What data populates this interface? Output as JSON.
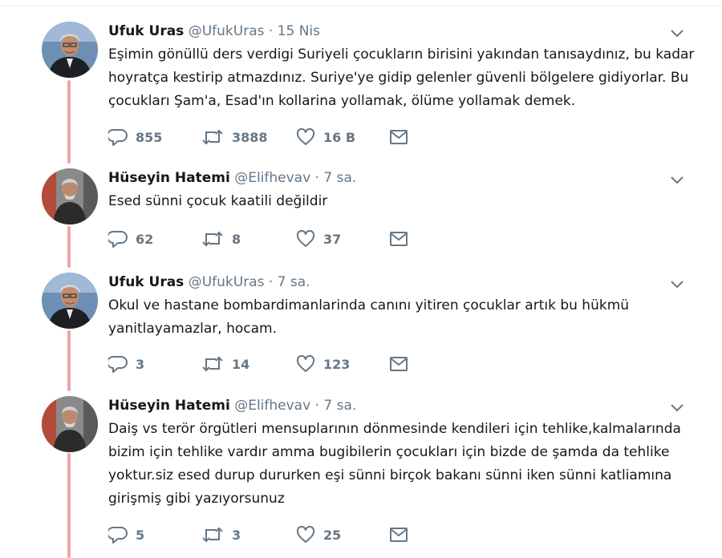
{
  "tweets": [
    {
      "name": "Ufuk Uras",
      "meta": "@UfukUras · 15 Nis",
      "text": "Eşimin gönüllü ders verdigi Suriyeli çocukların birisini yakından tanısaydınız, bu kadar hoyratça kestirip atmazdınız. Suriye'ye gidip gelenler güvenli bölgelere gidiyorlar. Bu çocukları Şam'a, Esad'ın kollarina yollamak, ölüme yollamak demek.",
      "replies": "855",
      "retweets": "3888",
      "likes": "16 B"
    },
    {
      "name": "Hüseyin Hatemi",
      "meta": "@Elifhevav · 7 sa.",
      "text": "Esed sünni çocuk kaatili değildir",
      "replies": "62",
      "retweets": "8",
      "likes": "37"
    },
    {
      "name": "Ufuk Uras",
      "meta": "@UfukUras · 7 sa.",
      "text": "Okul ve hastane bombardimanlarinda canını yitiren çocuklar artık bu hükmü yanitlayamazlar, hocam.",
      "replies": "3",
      "retweets": "14",
      "likes": "123"
    },
    {
      "name": "Hüseyin Hatemi",
      "meta": "@Elifhevav · 7 sa.",
      "text": "Daiş vs terör örgütleri mensuplarının dönmesinde kendileri için tehlike,kalmalarında bizim için tehlike vardır amma bugibilerin çocukları için bizde de şamda da tehlike yoktur.siz esed durup dururken eşi sünni birçok bakanı sünni iken sünni katliamına girişmiş gibi yazıyorsunuz",
      "replies": "5",
      "retweets": "3",
      "likes": "25"
    }
  ],
  "icons": {
    "reply": "reply-icon",
    "retweet": "retweet-icon",
    "like": "heart-icon",
    "message": "envelope-icon",
    "menu": "chevron-down-icon"
  },
  "colors": {
    "thread_line": "#f4a3a8",
    "secondary_text": "#657786",
    "primary_text": "#14171a"
  }
}
